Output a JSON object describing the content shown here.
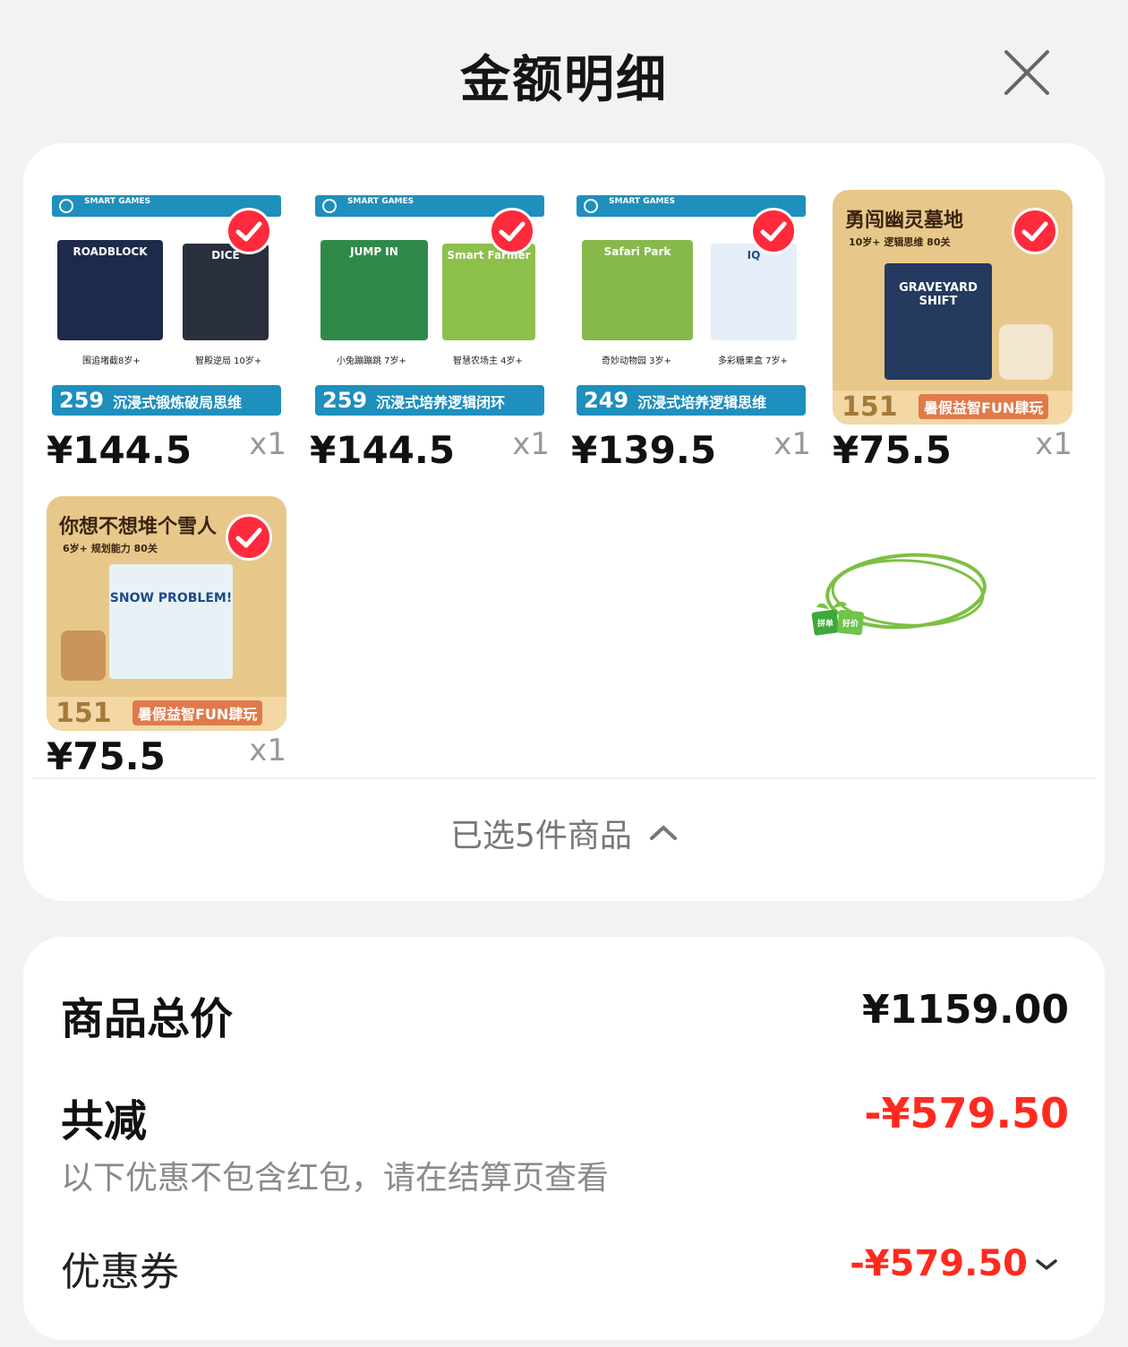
{
  "header": {
    "title": "金额明细"
  },
  "items": [
    {
      "price": "¥144.5",
      "qty": "x1",
      "style": "blue",
      "brand": "SMART GAMES",
      "box_a_label": "ROADBLOCK",
      "box_b_label": "DICE",
      "caption_a": "围追堵截8岁+",
      "caption_b": "智殿逆局 10岁+",
      "strip_num": "259",
      "strip_text": "沉浸式锻炼破局思维"
    },
    {
      "price": "¥144.5",
      "qty": "x1",
      "style": "blue",
      "brand": "SMART GAMES",
      "box_a_label": "JUMP IN",
      "box_b_label": "Smart Farmer",
      "caption_a": "小兔蹦蹦跳 7岁+",
      "caption_b": "智慧农场主 4岁+",
      "strip_num": "259",
      "strip_text": "沉浸式培养逻辑闭环"
    },
    {
      "price": "¥139.5",
      "qty": "x1",
      "style": "blue",
      "brand": "SMART GAMES",
      "box_a_label": "Safari Park",
      "box_b_label": "IQ",
      "caption_a": "奇妙动物园 3岁+",
      "caption_b": "多彩糖果盒 7岁+",
      "strip_num": "249",
      "strip_text": "沉浸式培养逻辑思维"
    },
    {
      "price": "¥75.5",
      "qty": "x1",
      "style": "warm",
      "headline": "勇闯幽灵墓地",
      "subline": "10岁+ 逻辑思维 80关",
      "box_label": "GRAVEYARD SHIFT",
      "num": "151",
      "slogan": "暑假益智FUN肆玩"
    },
    {
      "price": "¥75.5",
      "qty": "x1",
      "style": "warm",
      "headline": "你想不想堆个雪人",
      "subline": "6岁+ 规划能力 80关",
      "box_label": "SNOW PROBLEM!",
      "num": "151",
      "slogan": "暑假益智FUN肆玩"
    }
  ],
  "badge": {
    "top": "拼单",
    "bottom": "好价"
  },
  "selection": {
    "text": "已选5件商品"
  },
  "summary": {
    "total_label": "商品总价",
    "total_value": "¥1159.00",
    "reduce_label": "共减",
    "reduce_value": "-¥579.50",
    "reduce_note": "以下优惠不包含红包，请在结算页查看",
    "coupon_label": "优惠券",
    "coupon_value": "-¥579.50"
  },
  "colors": {
    "accent_red": "#ff2a1f",
    "check_red": "#ff2a3b",
    "brand_blue": "#1f8fbd",
    "circle_green": "#7cc043"
  }
}
